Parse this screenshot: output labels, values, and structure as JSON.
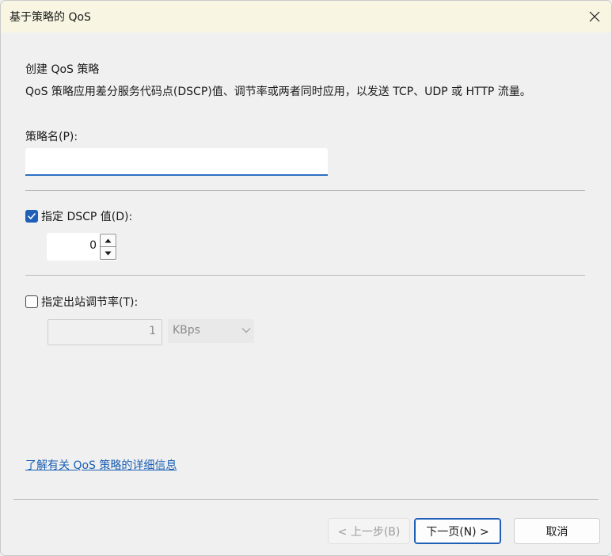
{
  "window": {
    "title": "基于策略的 QoS",
    "close_icon": "close-icon"
  },
  "header": {
    "title": "创建 QoS 策略",
    "description": "QoS 策略应用差分服务代码点(DSCP)值、调节率或两者同时应用，以发送 TCP、UDP 或 HTTP 流量。"
  },
  "policy_name": {
    "label": "策略名(P):",
    "value": ""
  },
  "dscp": {
    "label": "指定 DSCP 值(D):",
    "checked": true,
    "value": "0"
  },
  "throttle": {
    "label": "指定出站调节率(T):",
    "checked": false,
    "value": "1",
    "unit": "KBps"
  },
  "link": {
    "text": "了解有关 QoS 策略的详细信息"
  },
  "buttons": {
    "back": "< 上一步(B)",
    "next": "下一页(N) >",
    "cancel": "取消"
  },
  "colors": {
    "accent": "#1f5fb8",
    "link": "#1a5fb4",
    "titlebar": "#f8f6e2"
  }
}
